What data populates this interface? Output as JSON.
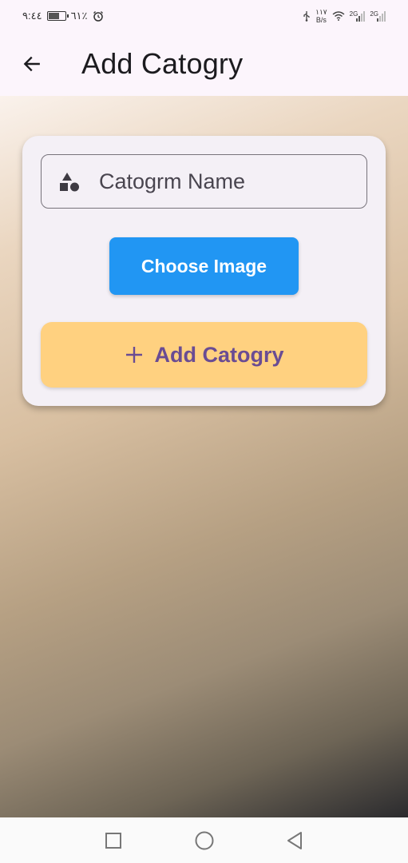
{
  "status_bar": {
    "time": "٩:٤٤",
    "battery_percent": "٦١٪",
    "net_speed_value": "١١٧",
    "net_speed_unit": "B/s",
    "signal_1_label": "2G",
    "signal_2_label": "2G",
    "battery_level": 0.61
  },
  "app_bar": {
    "title": "Add Catogry",
    "back_icon": "arrow-back-icon"
  },
  "form": {
    "name_field": {
      "placeholder": "Catogrm Name",
      "value": "",
      "icon": "category-shapes-icon"
    },
    "choose_image_label": "Choose Image",
    "add_button_label": "Add Catogry",
    "add_button_icon": "plus-icon"
  },
  "colors": {
    "choose_image_bg": "#2196f3",
    "add_button_bg": "#ffd180",
    "add_button_text": "#6a4c93",
    "card_bg": "#f4f0f6"
  },
  "nav_bar": {
    "items": [
      "recents-square-icon",
      "home-circle-icon",
      "back-triangle-icon"
    ]
  }
}
